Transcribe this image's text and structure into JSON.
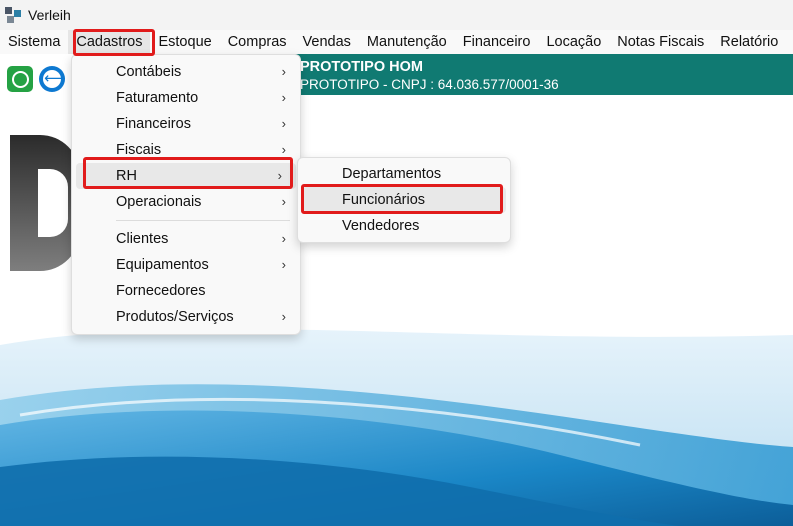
{
  "window": {
    "title": "Verleih"
  },
  "menubar": {
    "items": [
      "Sistema",
      "Cadastros",
      "Estoque",
      "Compras",
      "Vendas",
      "Manutenção",
      "Financeiro",
      "Locação",
      "Notas Fiscais",
      "Relatório"
    ]
  },
  "toolbar": {
    "icons": [
      "whatsapp-icon",
      "teamviewer-icon"
    ]
  },
  "company": {
    "name": "PROTOTIPO HOM",
    "cnpj": "PROTOTIPO - CNPJ : 64.036.577/0001-36"
  },
  "cadastros_menu": {
    "items": [
      {
        "label": "Contábeis",
        "submenu": true
      },
      {
        "label": "Faturamento",
        "submenu": true
      },
      {
        "label": "Financeiros",
        "submenu": true
      },
      {
        "label": "Fiscais",
        "submenu": true
      },
      {
        "label": "RH",
        "submenu": true
      },
      {
        "label": "Operacionais",
        "submenu": true
      },
      {
        "label": "Clientes",
        "submenu": true
      },
      {
        "label": "Equipamentos",
        "submenu": true
      },
      {
        "label": "Fornecedores",
        "submenu": false
      },
      {
        "label": "Produtos/Serviços",
        "submenu": true
      }
    ],
    "arrow": "›"
  },
  "rh_submenu": {
    "items": [
      {
        "label": "Departamentos"
      },
      {
        "label": "Funcionários"
      },
      {
        "label": "Vendedores"
      }
    ]
  },
  "colors": {
    "banner": "#107a72",
    "highlight": "#e11b1b",
    "wave_blue": "#1a86c6"
  }
}
